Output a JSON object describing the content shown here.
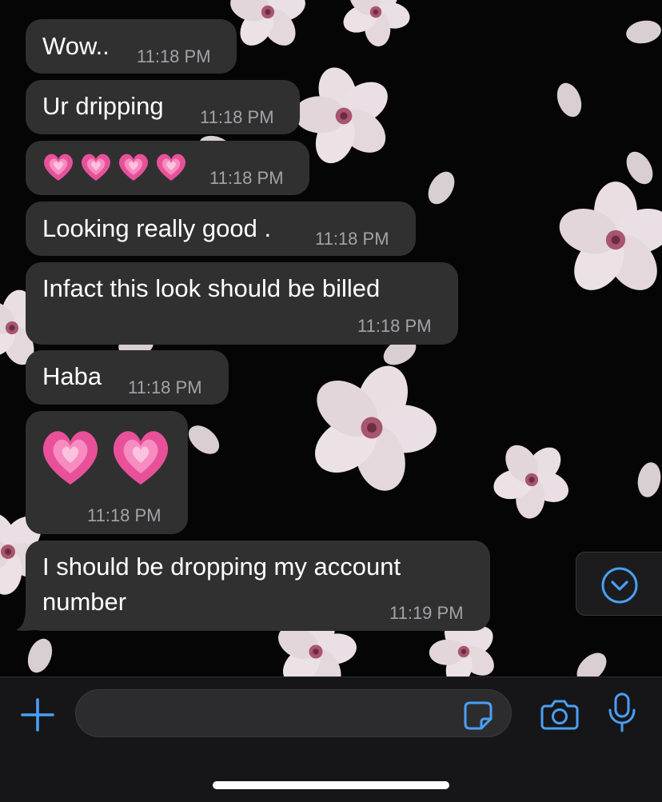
{
  "messages": [
    {
      "text": "Wow..",
      "time": "11:18 PM"
    },
    {
      "text": "Ur dripping",
      "time": "11:18 PM"
    },
    {
      "text": "💗💗💗💗",
      "time": "11:18 PM"
    },
    {
      "text": "Looking really good .",
      "time": "11:18 PM"
    },
    {
      "text": "Infact this look should be billed",
      "time": "11:18 PM"
    },
    {
      "text": "Haba",
      "time": "11:18 PM"
    },
    {
      "text": "💗💗",
      "time": "11:18 PM"
    },
    {
      "text_line1": "I should be dropping my account",
      "text_line2": "number",
      "time": "11:19 PM"
    }
  ],
  "input": {
    "placeholder": ""
  },
  "icons": {
    "plus": "plus-icon",
    "sticker": "sticker-icon",
    "camera": "camera-icon",
    "microphone": "microphone-icon",
    "scroll_down": "chevron-down-circle-icon",
    "heart_emoji": "growing-heart-emoji"
  },
  "colors": {
    "accent": "#4a9ff5",
    "bubble": "#303031",
    "timestamp": "#a3a3a8",
    "background": "#050505",
    "heart": "#e8519a"
  }
}
